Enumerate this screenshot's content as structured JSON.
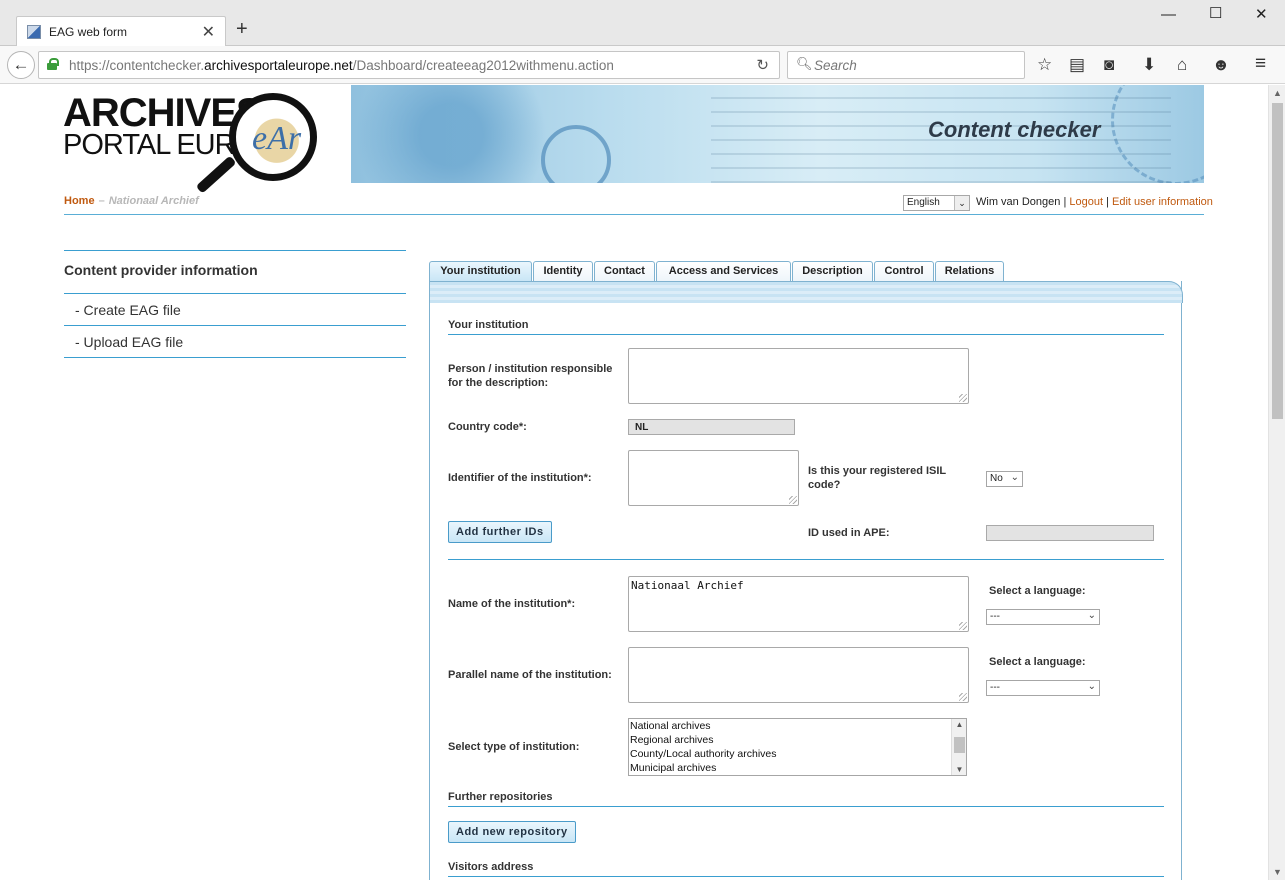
{
  "browser": {
    "tab_title": "EAG web form",
    "url_prefix": "https://contentchecker.",
    "url_domain": "archivesportaleurope.net",
    "url_path": "/Dashboard/createeag2012withmenu.action",
    "search_placeholder": "Search"
  },
  "header": {
    "logo_line1": "ARCHIVES",
    "logo_line2": "PORTAL EUROPE",
    "logo_mark": "eAr",
    "banner_title": "Content checker"
  },
  "breadcrumb": {
    "home": "Home",
    "separator": "–",
    "current": "Nationaal Archief"
  },
  "userbar": {
    "language": "English",
    "user_name": "Wim van Dongen",
    "logout": "Logout",
    "edit_user": "Edit user information",
    "sep": "|"
  },
  "sidebar": {
    "heading": "Content provider information",
    "items": [
      {
        "label": "- Create EAG file"
      },
      {
        "label": "- Upload EAG file"
      }
    ]
  },
  "tabs": [
    {
      "label": "Your institution"
    },
    {
      "label": "Identity"
    },
    {
      "label": "Contact"
    },
    {
      "label": "Access and Services"
    },
    {
      "label": "Description"
    },
    {
      "label": "Control"
    },
    {
      "label": "Relations"
    }
  ],
  "form": {
    "section_your_institution": "Your institution",
    "person_label": "Person / institution responsible for the description:",
    "person_value": "",
    "country_label": "Country code*:",
    "country_value": "NL",
    "identifier_label": "Identifier of the institution*:",
    "identifier_value": "",
    "isil_label": "Is this your registered ISIL code?",
    "isil_value": "No",
    "add_ids_button": "Add further IDs",
    "id_ape_label": "ID used in APE:",
    "id_ape_value": "",
    "name_label": "Name of the institution*:",
    "name_value": "Nationaal Archief",
    "name_lang_label": "Select a language:",
    "name_lang_value": "---",
    "parallel_label": "Parallel name of the institution:",
    "parallel_value": "",
    "parallel_lang_label": "Select a language:",
    "parallel_lang_value": "---",
    "type_label": "Select type of institution:",
    "type_options": [
      "National archives",
      "Regional archives",
      "County/Local authority archives",
      "Municipal archives"
    ],
    "section_further_repositories": "Further repositories",
    "add_repo_button": "Add new repository",
    "section_visitors_address": "Visitors address"
  },
  "colors": {
    "accent": "#3a9ed0",
    "link": "#c05a10",
    "button_bg": "#c9e6f6"
  }
}
